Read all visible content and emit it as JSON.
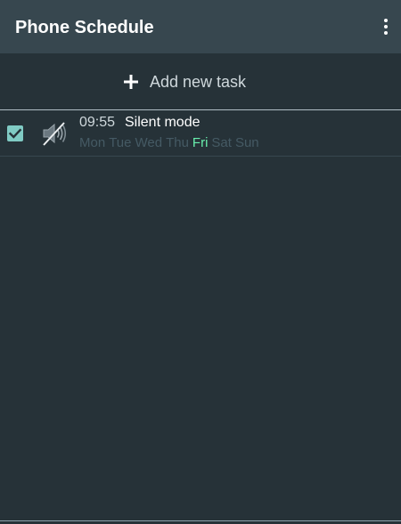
{
  "app_bar": {
    "title": "Phone Schedule",
    "menu_icon": "more-vert-icon"
  },
  "add_task": {
    "icon": "plus-icon",
    "label": "Add new task"
  },
  "tasks": [
    {
      "enabled": true,
      "icon": "speaker-muted-icon",
      "time": "09:55",
      "title": "Silent mode",
      "days": [
        {
          "label": "Mon",
          "active": false
        },
        {
          "label": "Tue",
          "active": false
        },
        {
          "label": "Wed",
          "active": false
        },
        {
          "label": "Thu",
          "active": false
        },
        {
          "label": "Fri",
          "active": true
        },
        {
          "label": "Sat",
          "active": false
        },
        {
          "label": "Sun",
          "active": false
        }
      ]
    }
  ],
  "colors": {
    "background": "#263238",
    "app_bar": "#37474f",
    "checkbox": "#80cbc4",
    "active_day": "#69f0ae",
    "inactive_day": "#455a64"
  }
}
